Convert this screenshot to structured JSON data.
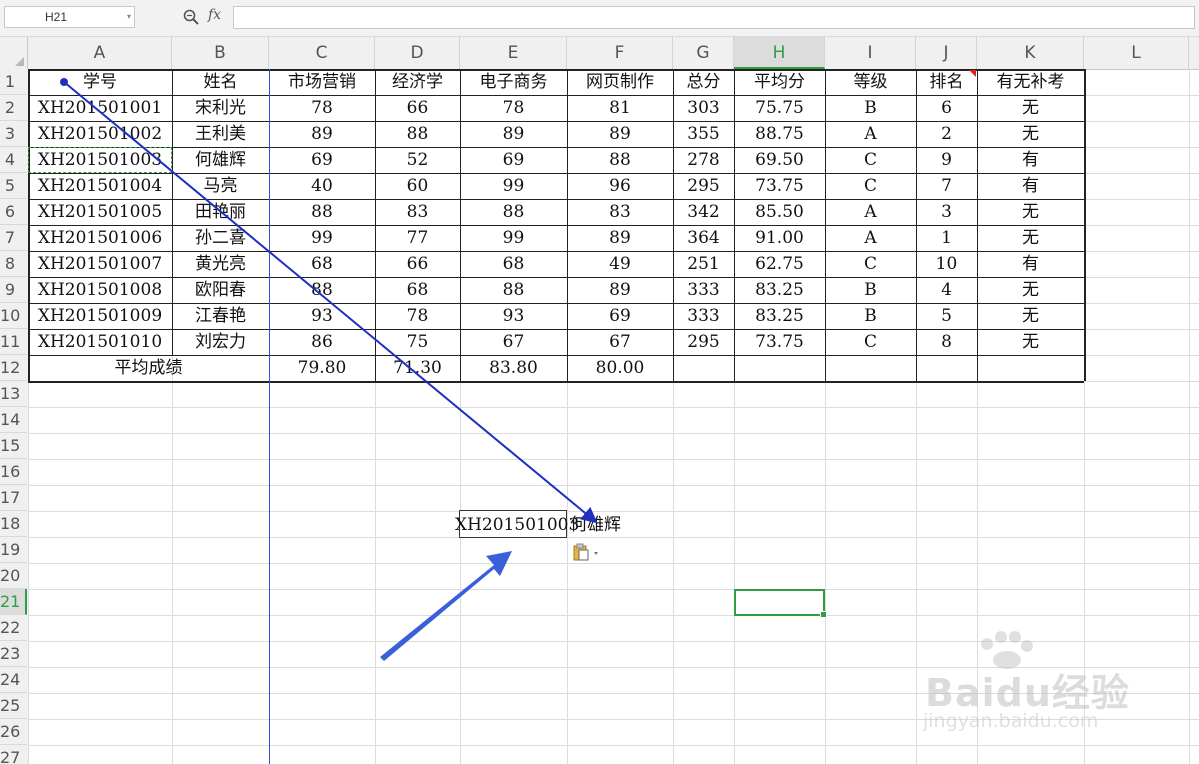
{
  "name_box": {
    "value": "H21"
  },
  "formula_bar": {
    "fx": "fx",
    "value": ""
  },
  "columns": [
    "A",
    "B",
    "C",
    "D",
    "E",
    "F",
    "G",
    "H",
    "I",
    "J",
    "K",
    "L"
  ],
  "rows": [
    "1",
    "2",
    "3",
    "4",
    "5",
    "6",
    "7",
    "8",
    "9",
    "10",
    "11",
    "12",
    "13",
    "14",
    "15",
    "16",
    "17",
    "18",
    "19",
    "20",
    "21",
    "22",
    "23",
    "24",
    "25",
    "26",
    "27"
  ],
  "table": {
    "headers": [
      "学号",
      "姓名",
      "市场营销",
      "经济学",
      "电子商务",
      "网页制作",
      "总分",
      "平均分",
      "等级",
      "排名",
      "有无补考"
    ],
    "records": [
      [
        "XH201501001",
        "宋利光",
        "78",
        "66",
        "78",
        "81",
        "303",
        "75.75",
        "B",
        "6",
        "无"
      ],
      [
        "XH201501002",
        "王利美",
        "89",
        "88",
        "89",
        "89",
        "355",
        "88.75",
        "A",
        "2",
        "无"
      ],
      [
        "XH201501003",
        "何雄辉",
        "69",
        "52",
        "69",
        "88",
        "278",
        "69.50",
        "C",
        "9",
        "有"
      ],
      [
        "XH201501004",
        "马亮",
        "40",
        "60",
        "99",
        "96",
        "295",
        "73.75",
        "C",
        "7",
        "有"
      ],
      [
        "XH201501005",
        "田艳丽",
        "88",
        "83",
        "88",
        "83",
        "342",
        "85.50",
        "A",
        "3",
        "无"
      ],
      [
        "XH201501006",
        "孙二喜",
        "99",
        "77",
        "99",
        "89",
        "364",
        "91.00",
        "A",
        "1",
        "无"
      ],
      [
        "XH201501007",
        "黄光亮",
        "68",
        "66",
        "68",
        "49",
        "251",
        "62.75",
        "C",
        "10",
        "有"
      ],
      [
        "XH201501008",
        "欧阳春",
        "88",
        "68",
        "88",
        "89",
        "333",
        "83.25",
        "B",
        "4",
        "无"
      ],
      [
        "XH201501009",
        "江春艳",
        "93",
        "78",
        "93",
        "69",
        "333",
        "83.25",
        "B",
        "5",
        "无"
      ],
      [
        "XH201501010",
        "刘宏力",
        "86",
        "75",
        "67",
        "67",
        "295",
        "73.75",
        "C",
        "8",
        "无"
      ]
    ],
    "avg_label": "平均成绩",
    "averages": [
      "79.80",
      "71.30",
      "83.80",
      "80.00"
    ]
  },
  "pasted": {
    "text1": "XH201501003",
    "text2": "何雄辉"
  },
  "watermark": {
    "main": "Baidu经验",
    "sub": "jingyan.baidu.com"
  },
  "colors": {
    "accent_green": "#2e9d46",
    "arrow_blue": "#1f2fc0",
    "big_arrow_blue": "#3a5fd8",
    "comment_red": "#d9251d"
  },
  "icons": [
    "zoom-icon",
    "paste-options-icon"
  ]
}
